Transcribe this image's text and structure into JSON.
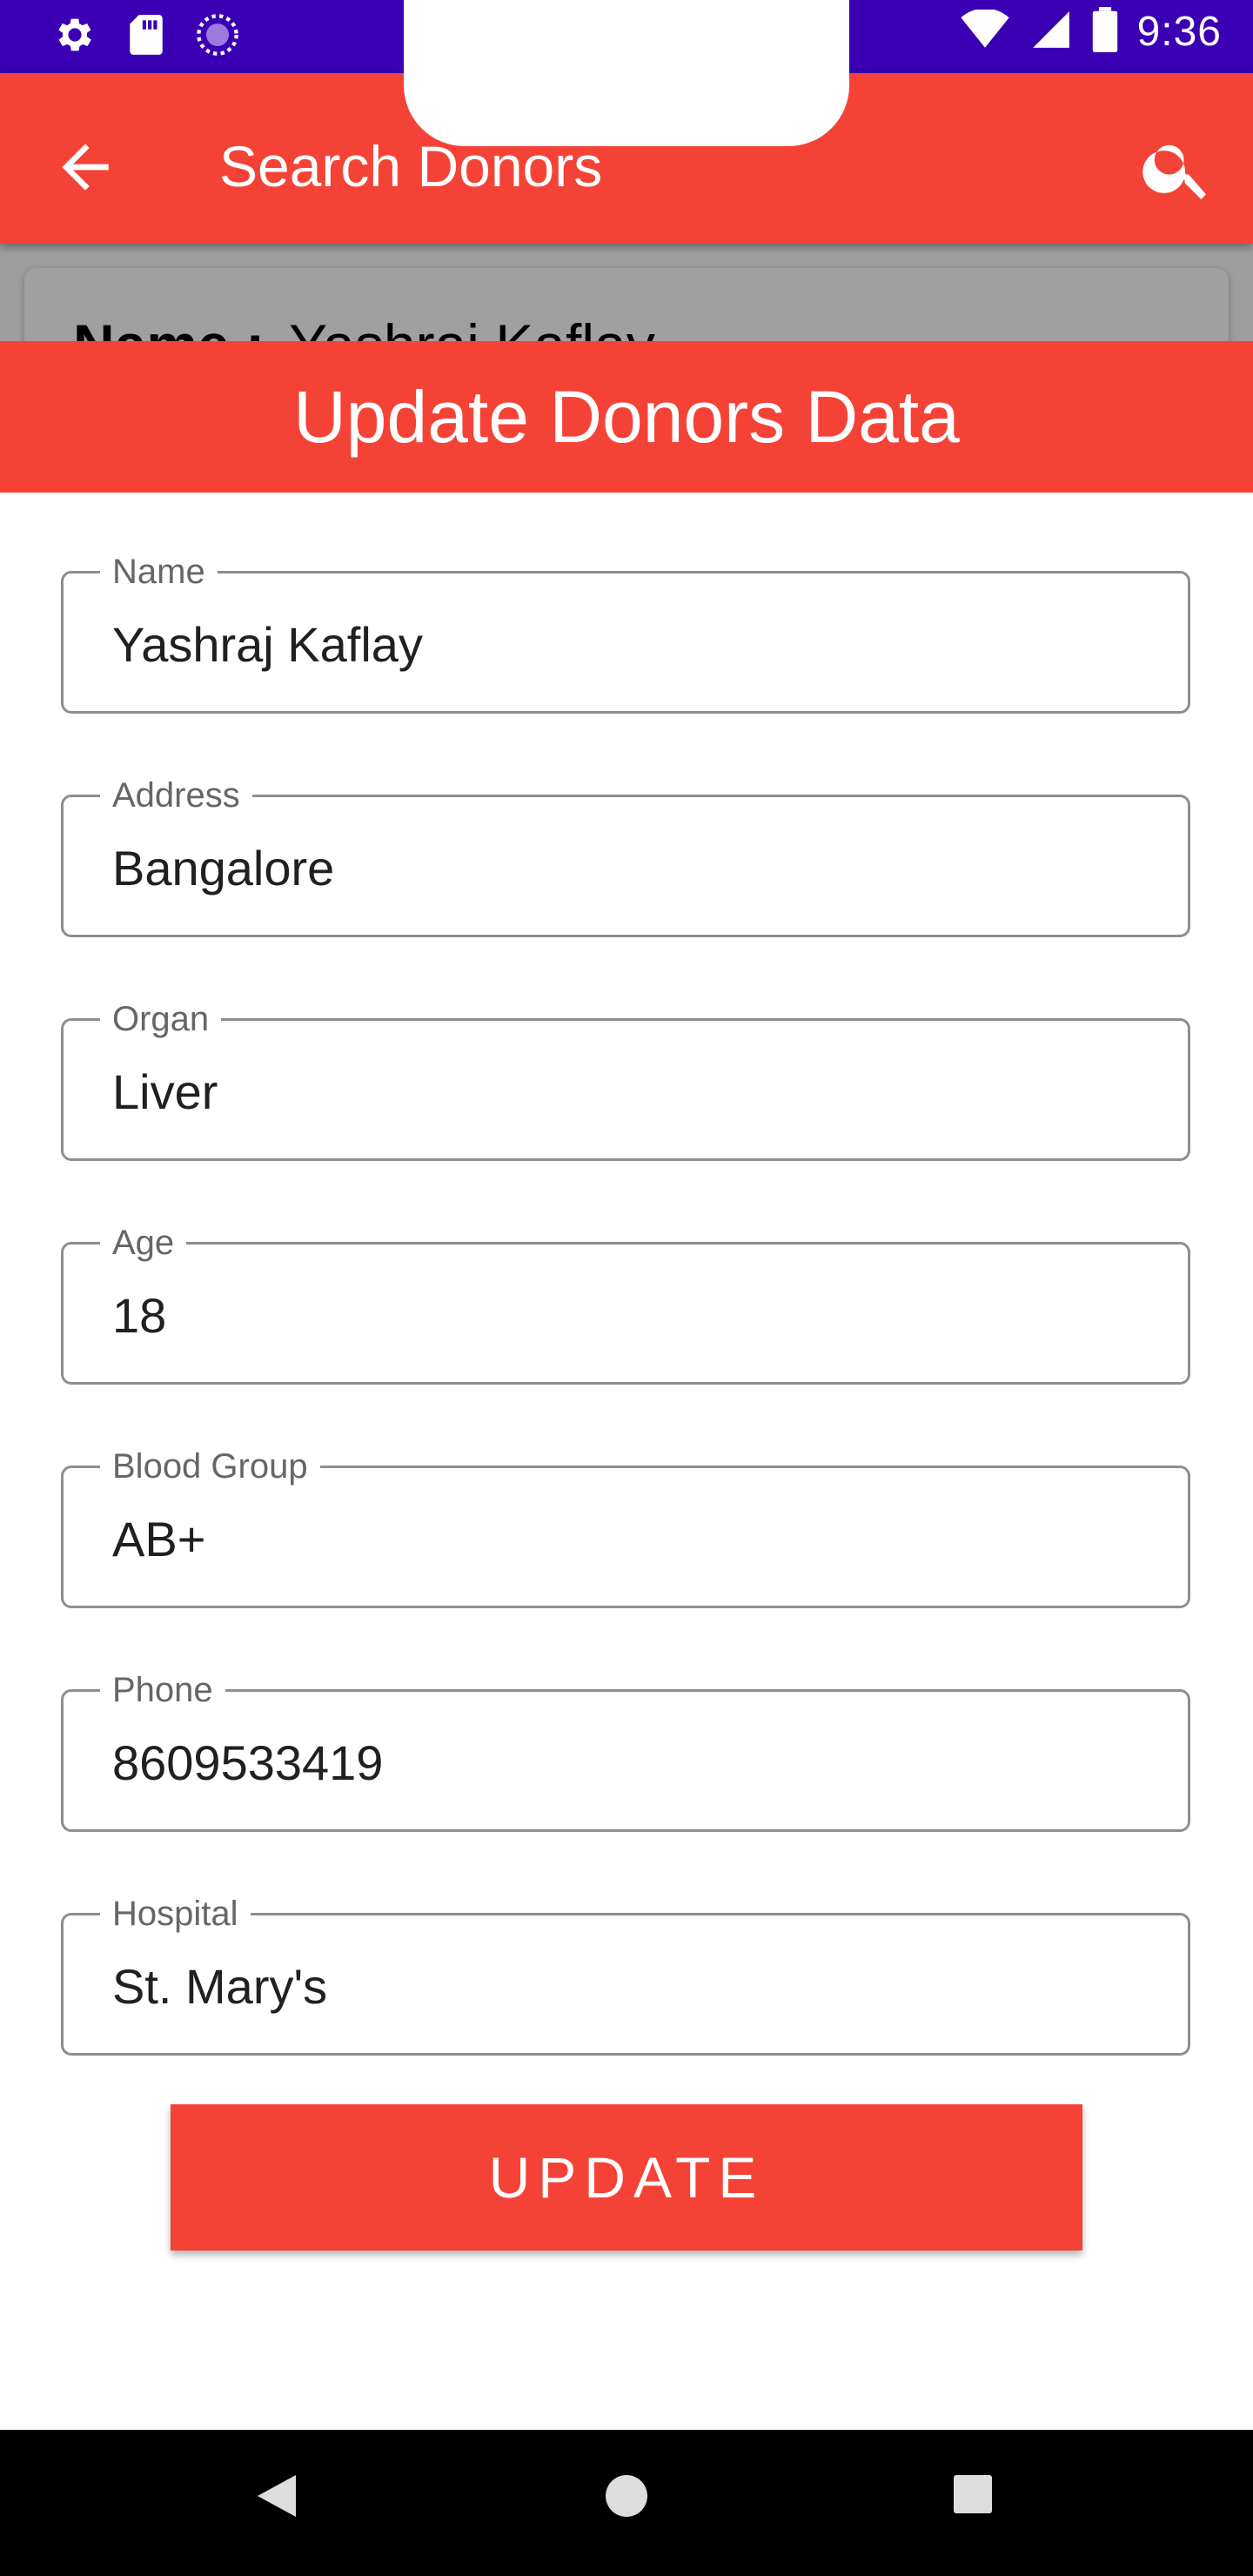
{
  "status_bar": {
    "time": "9:36",
    "icons_left": [
      "settings-icon",
      "sd-card-icon",
      "sync-circle-icon"
    ],
    "icons_right": [
      "wifi-icon",
      "cell-signal-icon",
      "battery-icon"
    ],
    "background": "#3B00B3"
  },
  "app_bar": {
    "title": "Search Donors",
    "back_icon": "arrow-back-icon",
    "search_icon": "search-icon",
    "background": "#F44336"
  },
  "background_card": {
    "name_label": "Name :",
    "name_value": "Yashraj Kaflay"
  },
  "dialog": {
    "title": "Update Donors Data",
    "fields": [
      {
        "label": "Name",
        "value": "Yashraj Kaflay"
      },
      {
        "label": "Address",
        "value": "Bangalore"
      },
      {
        "label": "Organ",
        "value": "Liver"
      },
      {
        "label": "Age",
        "value": "18"
      },
      {
        "label": "Blood Group",
        "value": "AB+"
      },
      {
        "label": "Phone",
        "value": "8609533419"
      },
      {
        "label": "Hospital",
        "value": "St. Mary's"
      }
    ],
    "update_label": "UPDATE",
    "accent": "#F44336"
  },
  "nav_bar": {
    "icons": [
      "nav-back-icon",
      "nav-home-icon",
      "nav-recents-icon"
    ]
  }
}
